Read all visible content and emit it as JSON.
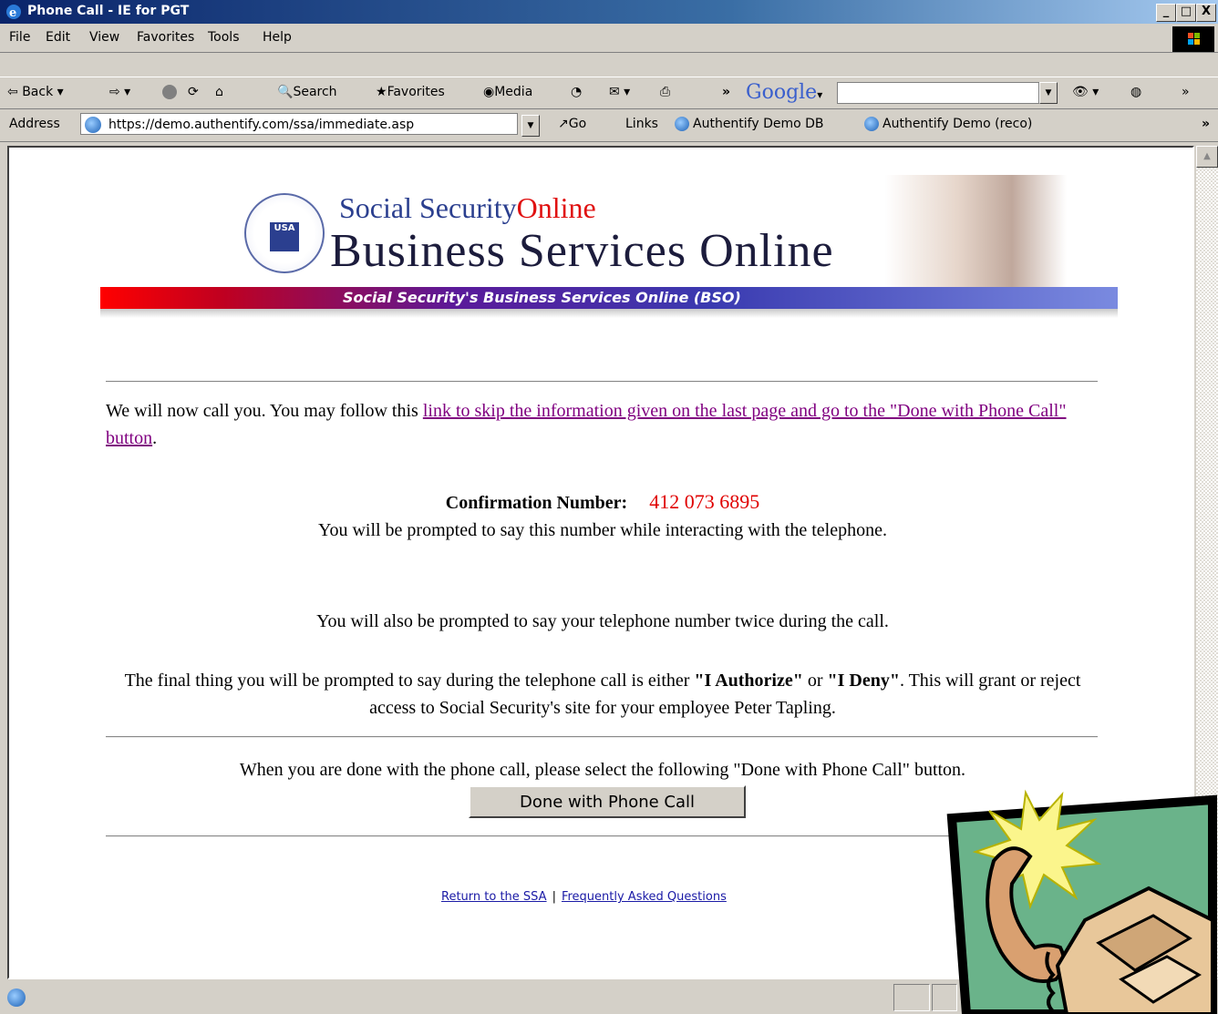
{
  "window": {
    "title": "Phone Call - IE for PGT",
    "controls": {
      "minimize": "_",
      "maximize": "□",
      "close": "X"
    }
  },
  "menu": {
    "items": [
      "File",
      "Edit",
      "View",
      "Favorites",
      "Tools",
      "Help"
    ]
  },
  "toolbar": {
    "back": "Back",
    "search": "Search",
    "favorites": "Favorites",
    "media": "Media",
    "google": "Google",
    "overflow": "»"
  },
  "address": {
    "label": "Address",
    "url": "https://demo.authentify.com/ssa/immediate.asp",
    "go": "Go",
    "links_label": "Links",
    "links": [
      "Authentify Demo DB",
      "Authentify Demo (reco)"
    ],
    "overflow": "»"
  },
  "banner": {
    "top_line_a": "Social Security",
    "top_line_b": "Online",
    "main_title": "Business Services Online",
    "subtitle": "Social Security's Business Services Online (BSO)",
    "seal_text": "USA"
  },
  "page": {
    "intro_prefix": "We will now call you. You may follow this ",
    "intro_link": "link to skip the information given on the last page and go to the \"Done with Phone Call\" button",
    "intro_suffix": ".",
    "confirmation_label": "Confirmation Number:",
    "confirmation_number": "412 073 6895",
    "confirmation_note": "You will be prompted to say this number while interacting with the telephone.",
    "phone_note": "You will also be prompted to say your telephone number twice during the call.",
    "final_prefix": "The final thing you will be prompted to say during the telephone call is either ",
    "authorize": "\"I Authorize\"",
    "or": " or ",
    "deny": "\"I Deny\"",
    "final_suffix": ". This will grant or reject access to Social Security's site for your employee Peter Tapling.",
    "done_note": "When you are done with the phone call, please select the following \"Done with Phone Call\" button.",
    "done_button": "Done with Phone Call"
  },
  "footer": {
    "link1": "Return to the SSA",
    "separator": "|",
    "link2": "Frequently Asked Questions"
  },
  "colors": {
    "link_visited": "#800080",
    "confirmation": "#e00000",
    "footer_link": "#1a1aa6"
  }
}
